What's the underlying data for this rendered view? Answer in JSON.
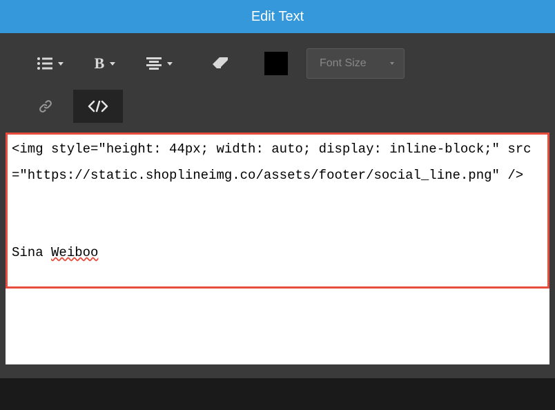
{
  "title": "Edit Text",
  "toolbar": {
    "font_size_label": "Font Size",
    "color_swatch_hex": "#000000"
  },
  "editor": {
    "code_text": "<img style=\"height: 44px; width: auto; display: inline-block;\" src=\"https://static.shoplineimg.co/assets/footer/social_line.png\" />",
    "plain_text_prefix": "Sina ",
    "plain_text_err": "Weiboo"
  }
}
